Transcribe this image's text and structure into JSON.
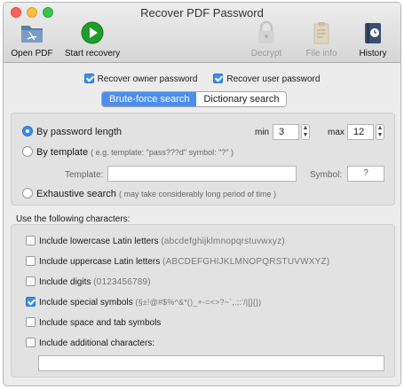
{
  "window": {
    "title": "Recover PDF Password"
  },
  "toolbar": {
    "open_pdf": "Open PDF",
    "start_recovery": "Start recovery",
    "decrypt": "Decrypt",
    "file_info": "File info",
    "history": "History"
  },
  "options": {
    "recover_owner": "Recover owner password",
    "recover_user": "Recover user password"
  },
  "modes": {
    "brute_force": "Brute-force search",
    "dictionary": "Dictionary search"
  },
  "brute": {
    "by_length": "By password length",
    "min_label": "min",
    "min_value": "3",
    "max_label": "max",
    "max_value": "12",
    "by_template": "By template",
    "template_hint": "( e.g. template: \"pass???d\" symbol: \"?\" )",
    "template_label": "Template:",
    "symbol_label": "Symbol:",
    "symbol_value": "?",
    "exhaustive": "Exhaustive search",
    "exhaustive_hint": "( may take considerably long period of time )"
  },
  "charset": {
    "section_label": "Use the following characters:",
    "items": [
      {
        "label": "Include lowercase Latin letters",
        "sample": "(abcdefghijklmnopqrstuvwxyz)",
        "checked": false
      },
      {
        "label": "Include uppercase Latin letters",
        "sample": "(ABCDEFGHIJKLMNOPQRSTUVWXYZ)",
        "checked": false
      },
      {
        "label": "Include digits",
        "sample": "(0123456789)",
        "checked": false
      },
      {
        "label": "Include special symbols",
        "sample": "(§±!@#$%^&*()_+-=<>?~`,.;:'/|[]{})",
        "checked": true
      },
      {
        "label": "Include space and tab symbols",
        "sample": "",
        "checked": false
      },
      {
        "label": "Include additional characters:",
        "sample": "",
        "checked": false
      }
    ]
  },
  "colors": {
    "accent": "#4a8ef0",
    "start_green": "#1f9d2a"
  }
}
